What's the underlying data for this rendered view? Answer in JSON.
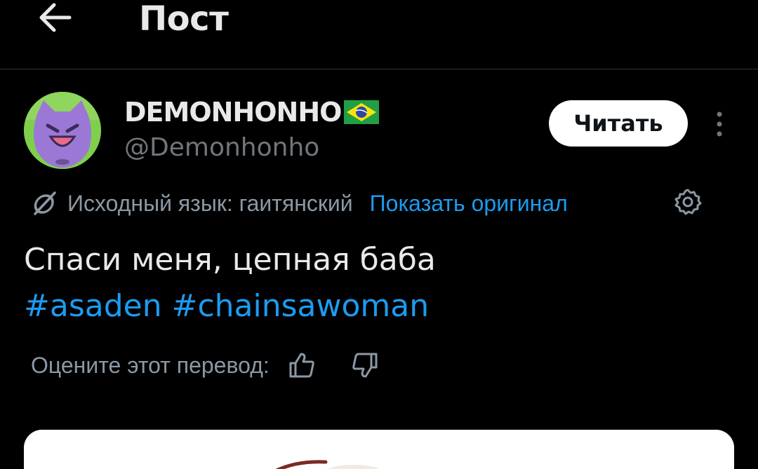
{
  "header": {
    "title": "Пост",
    "back_icon": "arrow-left-icon"
  },
  "author": {
    "name": "DEMONHONHO",
    "flag_icon": "brazil-flag-icon",
    "handle": "@Demonhonho",
    "follow_label": "Читать",
    "more_icon": "more-vertical-icon"
  },
  "translation": {
    "icon": "translate-icon",
    "label": "Исходный язык: гаитянский",
    "show_original": "Показать оригинал",
    "settings_icon": "gear-icon"
  },
  "post": {
    "text": "Спаси меня, цепная баба",
    "hashtags": [
      "#asaden",
      "#chainsawoman"
    ]
  },
  "rating": {
    "label": "Оцените этот перевод:",
    "up_icon": "thumbs-up-icon",
    "down_icon": "thumbs-down-icon"
  },
  "colors": {
    "background": "#000000",
    "text": "#e7e9ea",
    "muted": "#71767b",
    "link": "#1d9bf0",
    "divider": "#2f3336"
  }
}
